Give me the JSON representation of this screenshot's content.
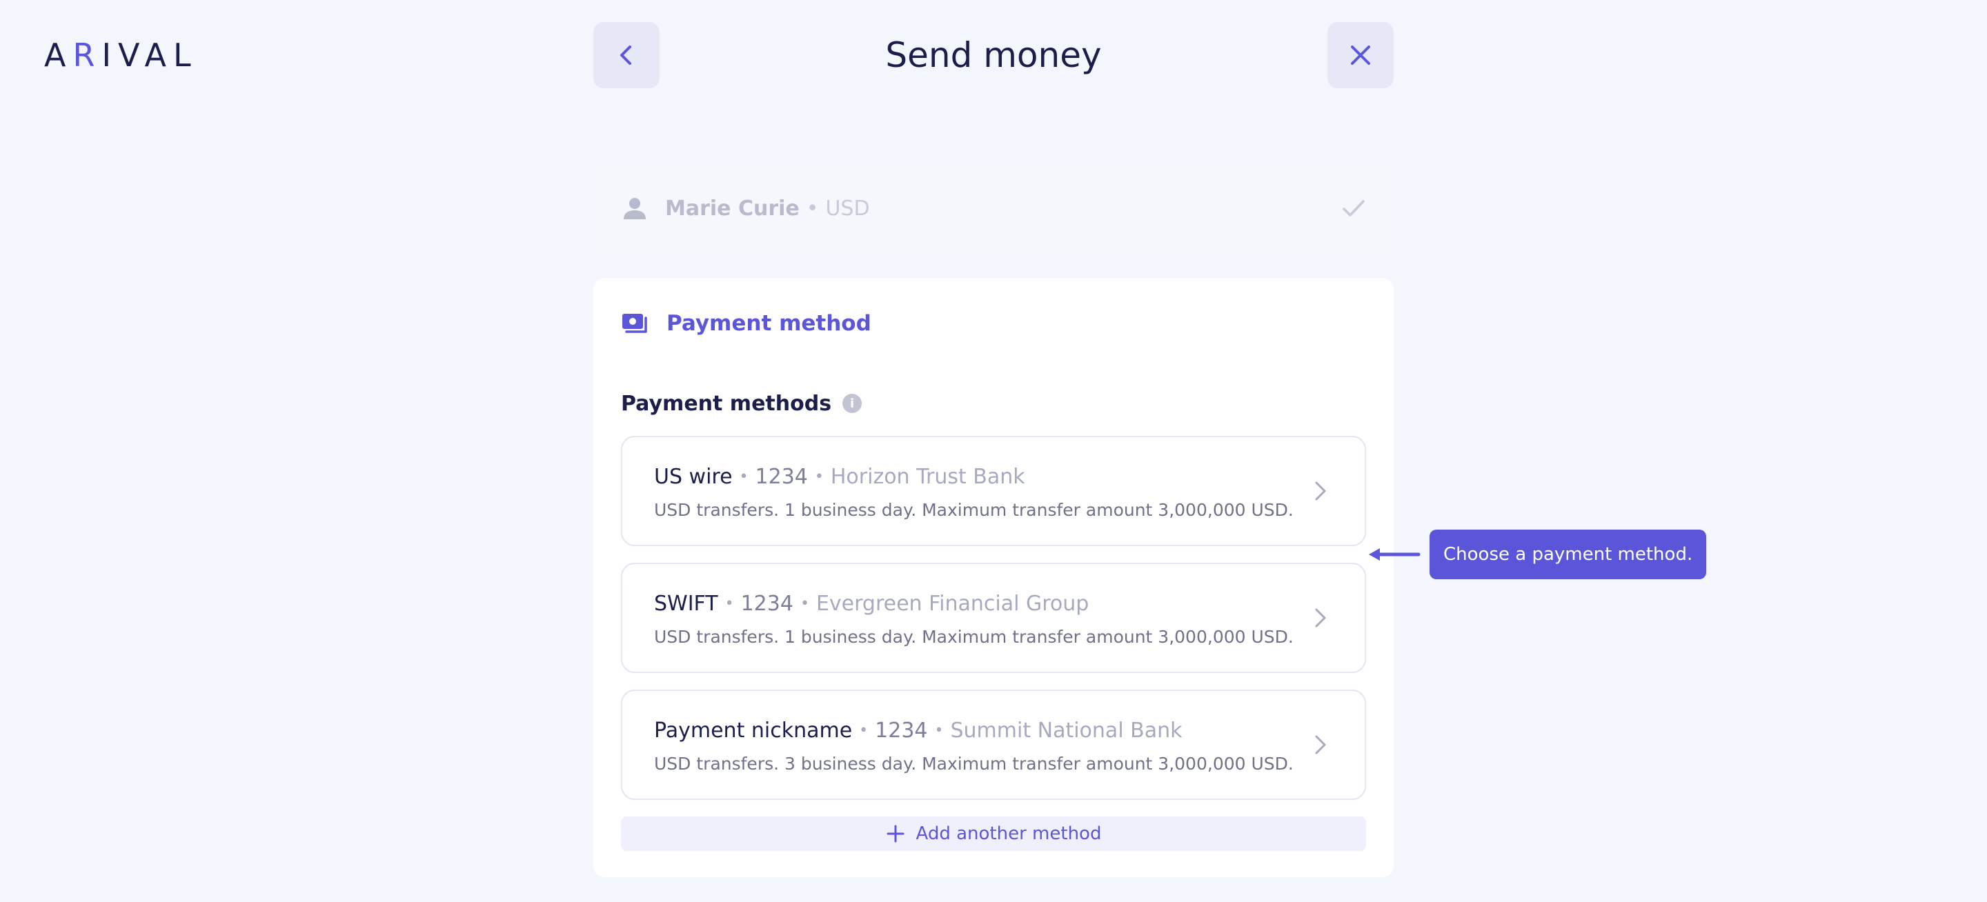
{
  "app": {
    "logo_text_a": "A",
    "logo_text_r": "R",
    "logo_text_rest": "IVAL"
  },
  "header": {
    "title": "Send money",
    "back_icon": "chevron-left-icon",
    "close_icon": "close-icon"
  },
  "recipient": {
    "name": "Marie Curie",
    "separator": "•",
    "currency": "USD",
    "icon": "person-icon",
    "status_icon": "check-icon"
  },
  "payment_section": {
    "title": "Payment method",
    "icon": "money-icon",
    "methods_label": "Payment methods",
    "info_icon_glyph": "i",
    "methods": [
      {
        "name": "US wire",
        "sep1": "•",
        "account": "1234",
        "sep2": "•",
        "bank": "Horizon Trust Bank",
        "description": "USD transfers. 1 business day. Maximum transfer amount 3,000,000 USD."
      },
      {
        "name": "SWIFT",
        "sep1": "•",
        "account": "1234",
        "sep2": "•",
        "bank": "Evergreen Financial Group",
        "description": "USD transfers. 1 business day. Maximum transfer amount 3,000,000 USD."
      },
      {
        "name": "Payment nickname",
        "sep1": "•",
        "account": "1234",
        "sep2": "•",
        "bank": "Summit National Bank",
        "description": "USD transfers. 3 business day. Maximum transfer amount 3,000,000 USD."
      }
    ],
    "add_method_label": "Add another method"
  },
  "tooltip": {
    "text": "Choose a payment method."
  },
  "colors": {
    "accent": "#5b55d9",
    "background": "#f4f6fd",
    "text_primary": "#1b1d4a",
    "text_muted": "#a7a9bf"
  }
}
